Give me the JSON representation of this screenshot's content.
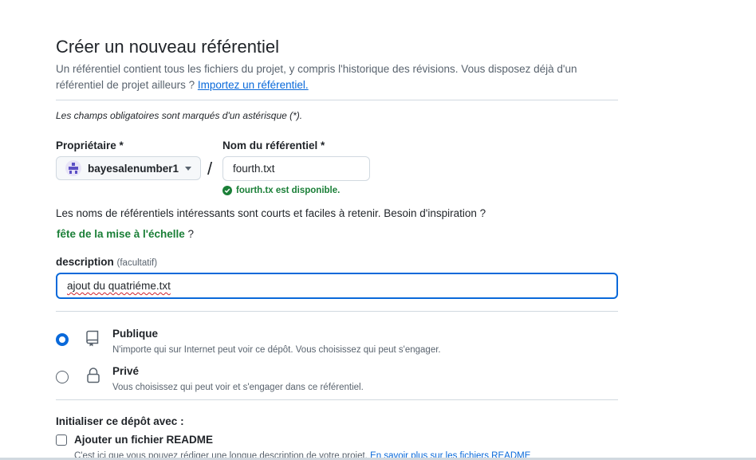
{
  "page": {
    "title": "Créer un nouveau référentiel",
    "intro_text": "Un référentiel contient tous les fichiers du projet, y compris l'historique des révisions. Vous disposez déjà d'un référentiel de projet ailleurs ? ",
    "import_link": "Importez un référentiel.",
    "required_note": "Les champs obligatoires sont marqués d'un astérisque (*)."
  },
  "owner": {
    "label": "Propriétaire *",
    "value": "bayesalenumber1",
    "icon": "avatar"
  },
  "repo_name": {
    "label": "Nom du référentiel *",
    "value": "fourth.txt",
    "separator": "/",
    "availability": "fourth.tx est disponible.",
    "availability_icon": "check-circle-icon"
  },
  "naming_hint": {
    "text": "Les noms de référentiels intéressants sont courts et faciles à retenir. Besoin d'inspiration ?",
    "suggestion": "fête de la mise à l'échelle",
    "suggestion_suffix": " ?"
  },
  "description": {
    "label": "description",
    "optional": "(facultatif)",
    "value": "ajout du quatriéme.txt"
  },
  "visibility": {
    "options": [
      {
        "title": "Publique",
        "desc": "N'importe qui sur Internet peut voir ce dépôt. Vous choisissez qui peut s'engager.",
        "icon": "repo-icon",
        "checked": true
      },
      {
        "title": "Privé",
        "desc": "Vous choisissez qui peut voir et s'engager dans ce référentiel.",
        "icon": "lock-icon",
        "checked": false
      }
    ]
  },
  "init": {
    "title": "Initialiser ce dépôt avec :",
    "readme_label": "Ajouter un fichier README",
    "readme_desc": "C'est ici que vous pouvez rédiger une longue description de votre projet. ",
    "readme_link": "En savoir plus sur les fichiers README",
    "readme_checked": false
  },
  "colors": {
    "accent": "#0969da",
    "success": "#1a7f37",
    "muted": "#59636e",
    "border": "#d1d9e0"
  }
}
